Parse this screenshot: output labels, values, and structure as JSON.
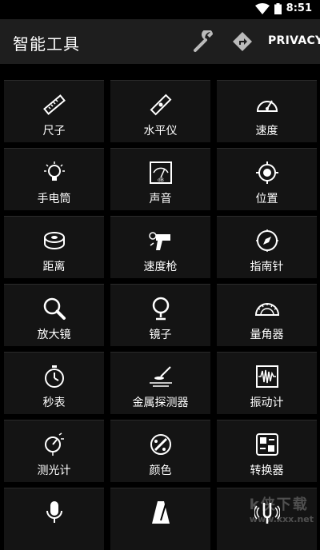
{
  "status_bar": {
    "time": "8:51"
  },
  "app_bar": {
    "title": "智能工具",
    "privacy_label": "PRIVACY",
    "wrench_icon": "wrench-icon",
    "direction_icon": "direction-sign-icon"
  },
  "tools": [
    {
      "label": "尺子",
      "icon": "ruler-icon"
    },
    {
      "label": "水平仪",
      "icon": "spirit-level-icon"
    },
    {
      "label": "速度",
      "icon": "speedometer-icon"
    },
    {
      "label": "手电筒",
      "icon": "lightbulb-icon"
    },
    {
      "label": "声音",
      "icon": "decibel-meter-icon"
    },
    {
      "label": "位置",
      "icon": "location-target-icon"
    },
    {
      "label": "距离",
      "icon": "tape-measure-icon"
    },
    {
      "label": "速度枪",
      "icon": "speed-gun-icon"
    },
    {
      "label": "指南针",
      "icon": "compass-icon"
    },
    {
      "label": "放大镜",
      "icon": "magnifier-icon"
    },
    {
      "label": "镜子",
      "icon": "mirror-icon"
    },
    {
      "label": "量角器",
      "icon": "protractor-icon"
    },
    {
      "label": "秒表",
      "icon": "stopwatch-icon"
    },
    {
      "label": "金属探测器",
      "icon": "metal-detector-icon"
    },
    {
      "label": "振动计",
      "icon": "vibration-meter-icon"
    },
    {
      "label": "测光计",
      "icon": "light-meter-icon"
    },
    {
      "label": "颜色",
      "icon": "color-palette-icon"
    },
    {
      "label": "转换器",
      "icon": "converter-icon"
    },
    {
      "label": "",
      "icon": "microphone-icon"
    },
    {
      "label": "",
      "icon": "metronome-icon"
    },
    {
      "label": "",
      "icon": "tuning-fork-icon"
    }
  ],
  "watermark": {
    "text": "k侠下载",
    "url": "www.kxx.net"
  }
}
